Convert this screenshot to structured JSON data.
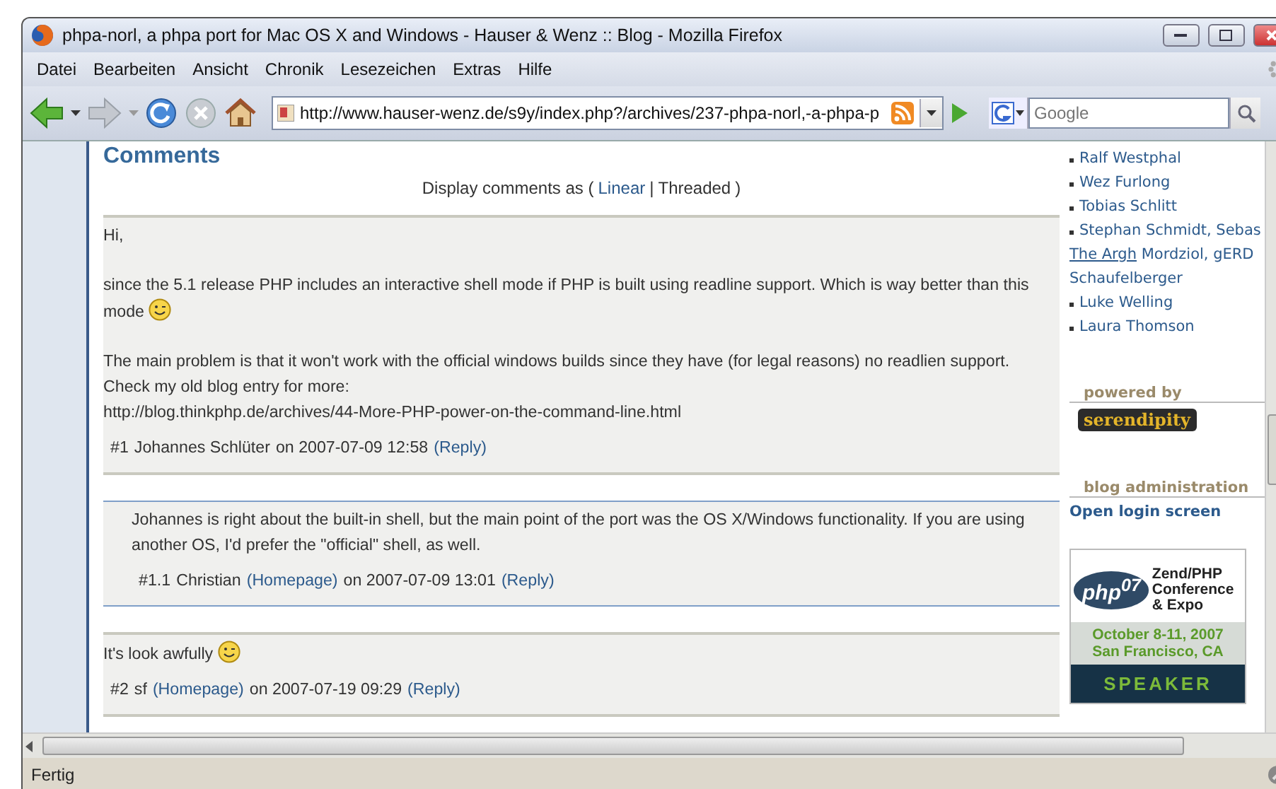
{
  "window": {
    "title": "phpa-norl, a phpa port for Mac OS X and Windows - Hauser & Wenz :: Blog - Mozilla Firefox"
  },
  "menu": [
    "Datei",
    "Bearbeiten",
    "Ansicht",
    "Chronik",
    "Lesezeichen",
    "Extras",
    "Hilfe"
  ],
  "address_bar": {
    "value": "http://www.hauser-wenz.de/s9y/index.php?/archives/237-phpa-norl,-a-phpa-p"
  },
  "search_field": {
    "placeholder": "Google"
  },
  "comments": {
    "heading": "Comments",
    "display_label": "Display comments as (",
    "options": [
      {
        "label": "Linear",
        "selected": false
      },
      {
        "label": "Threaded",
        "selected": true
      }
    ],
    "separator": "|",
    "suffix": ")",
    "items": [
      {
        "paragraphs": [
          {
            "text": "Hi,",
            "smiley": false
          },
          {
            "text": "since the 5.1 release PHP includes an interactive shell mode if PHP is built using readline support. Which is way better than this mode",
            "smiley": true
          },
          {
            "text": "The main problem is that it won't work with the official windows builds since they have (for legal reasons) no readlien support. Check my old blog entry for more:",
            "url": "http://blog.thinkphp.de/archives/44-More-PHP-power-on-the-command-line.html",
            "smiley": false
          }
        ],
        "number": "#1",
        "author": "Johannes Schlüter",
        "date": "on 2007-07-09 12:58",
        "reply": "(Reply)",
        "children": [
          {
            "paragraphs": [
              {
                "text": "Johannes is right about the built-in shell, but the main point of the port was the OS X/Windows functionality. If you are using another OS, I'd prefer the \"official\" shell, as well.",
                "smiley": false
              }
            ],
            "number": "#1.1",
            "author": "Christian",
            "homepage": "(Homepage)",
            "date": "on 2007-07-09 13:01",
            "reply": "(Reply)"
          }
        ]
      },
      {
        "paragraphs": [
          {
            "text": "It's look awfully",
            "smiley": true
          }
        ],
        "number": "#2",
        "author": "sf",
        "homepage": "(Homepage)",
        "date": "on 2007-07-19 09:29",
        "reply": "(Reply)"
      }
    ]
  },
  "sidebar": {
    "authors": [
      {
        "name": "Ralf Westphal"
      },
      {
        "name": "Wez Furlong"
      },
      {
        "name": "Tobias Schlitt"
      },
      {
        "name": "Stephan Schmidt, Sebas",
        "continuation": [
          {
            "text": "The Argh",
            "hovered": true
          },
          {
            "text": "Mordziol, gERD",
            "hovered": false
          },
          {
            "text": "Schaufelberger",
            "hovered": false
          }
        ]
      },
      {
        "name": "Luke Welling"
      },
      {
        "name": "Laura Thomson"
      }
    ],
    "powered_by": "powered by",
    "powered_logo": "serendipity",
    "admin_heading": "blog administration",
    "login_link": "Open login screen",
    "ad": {
      "logo_text": "php$^{07}$",
      "lines": [
        "Zend/PHP",
        "Conference",
        "& Expo"
      ],
      "date": "October 8-11, 2007",
      "place": "San Francisco, CA",
      "badge": "SPEAKER"
    }
  },
  "status_bar": {
    "text": "Fertig"
  }
}
